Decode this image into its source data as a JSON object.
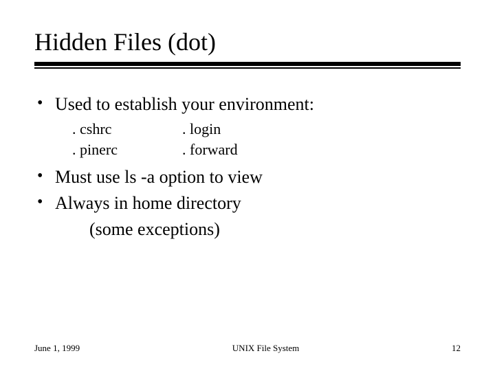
{
  "title": "Hidden Files (dot)",
  "bullets": {
    "b1": "Used to establish your environment:",
    "b2": "Must use ls -a option to view",
    "b3": "Always in home directory",
    "b3_sub": "(some exceptions)"
  },
  "files": {
    "r1c1": ". cshrc",
    "r1c2": ". login",
    "r2c1": ". pinerc",
    "r2c2": ". forward"
  },
  "footer": {
    "date": "June 1, 1999",
    "center": "UNIX File System",
    "page": "12"
  }
}
